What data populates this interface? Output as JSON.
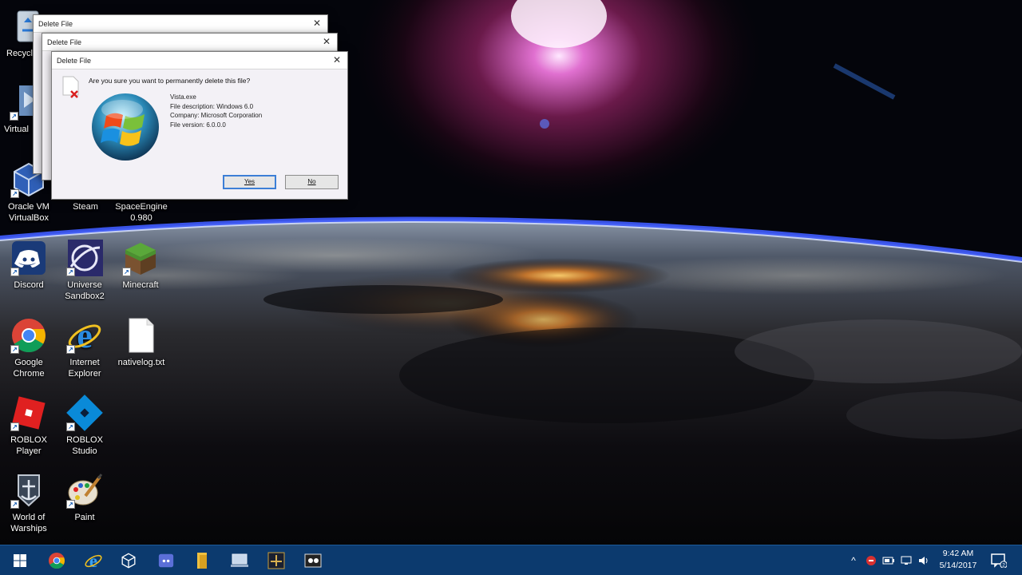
{
  "desktop_icons": {
    "recycle_bin": "Recycl",
    "virtual": "Virtual",
    "oracle_vm": "Oracle VM VirtualBox",
    "steam": "Steam",
    "spaceengine": "SpaceEngine 0.980",
    "discord": "Discord",
    "universe_sandbox": "Universe Sandbox2",
    "minecraft": "Minecraft",
    "google_chrome": "Google Chrome",
    "internet_explorer": "Internet Explorer",
    "nativelog": "nativelog.txt",
    "roblox_player": "ROBLOX Player",
    "roblox_studio": "ROBLOX Studio",
    "world_of_warships": "World of Warships",
    "paint": "Paint"
  },
  "dialogs": {
    "back2": {
      "title": "Delete File"
    },
    "back1": {
      "title": "Delete File"
    },
    "main": {
      "title": "Delete File",
      "question": "Are you sure you want to permanently delete this file?",
      "filename": "Vista.exe",
      "description": "File description: Windows 6.0",
      "company": "Company: Microsoft Corporation",
      "version": "File version: 6.0.0.0",
      "yes_label": "Yes",
      "no_label": "No"
    }
  },
  "taskbar": {
    "items": [
      "start-icon",
      "chrome-icon",
      "internet-explorer-icon",
      "virtualbox-icon",
      "discord-icon",
      "file-explorer-icon",
      "network-computer-icon",
      "spaceengine-icon",
      "media-icon"
    ],
    "clock_time": "9:42 AM",
    "clock_date": "5/14/2017",
    "notification_count": "2"
  },
  "colors": {
    "taskbar": "#0c3a6e",
    "dialog_bg": "#f2f0f4",
    "default_button_border": "#3c7fd6"
  }
}
